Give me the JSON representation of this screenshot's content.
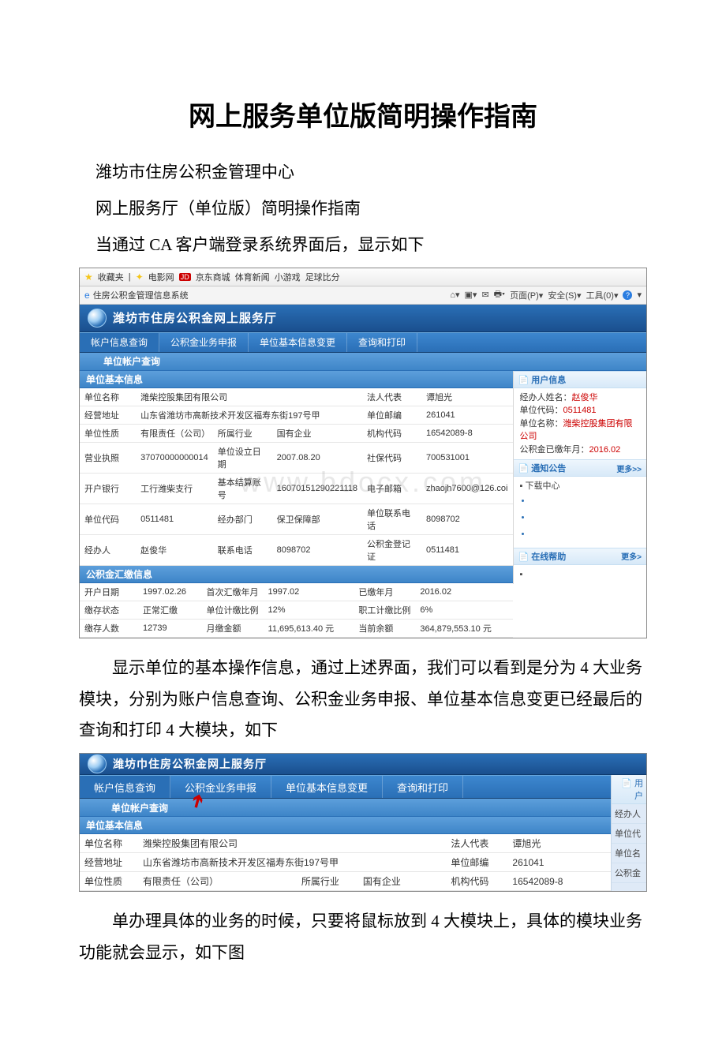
{
  "title": "网上服务单位版简明操作指南",
  "para1": "潍坊市住房公积金管理中心",
  "para2": "网上服务厅（单位版）简明操作指南",
  "para3": "当通过 CA 客户端登录系统界面后，显示如下",
  "para4": "显示单位的基本操作信息，通过上述界面，我们可以看到是分为 4 大业务模块，分别为账户信息查询、公积金业务申报、单位基本信息变更已经最后的查询和打印 4 大模块，如下",
  "para5": "单办理具体的业务的时候，只要将鼠标放到 4 大模块上，具体的模块业务功能就会显示，如下图",
  "favorites": {
    "label": "收藏夹",
    "links": [
      "电影网",
      "京东商城",
      "体育新闻",
      "小游戏",
      "足球比分"
    ]
  },
  "tab_title": "住房公积金管理信息系统",
  "ie_tools": [
    "页面(P)▾",
    "安全(S)▾",
    "工具(0)▾"
  ],
  "banner_text": "潍坊市住房公积金网上服务厅",
  "menu": [
    "帐户信息查询",
    "公积金业务申报",
    "单位基本信息变更",
    "查询和打印"
  ],
  "submenu": "单位帐户查询",
  "sec_basic": "单位基本信息",
  "sec_fund": "公积金汇缴信息",
  "basic": {
    "r1a": "单位名称",
    "r1av": "潍柴控股集团有限公司",
    "r1c": "法人代表",
    "r1cv": "谭旭光",
    "r2a": "经营地址",
    "r2av": "山东省潍坊市高新技术开发区福寿东街197号甲",
    "r2c": "单位邮编",
    "r2cv": "261041",
    "r3a": "单位性质",
    "r3av": "有限责任（公司）",
    "r3b": "所属行业",
    "r3bv": "国有企业",
    "r3c": "机构代码",
    "r3cv": "16542089-8",
    "r4a": "营业执照",
    "r4av": "37070000000014",
    "r4b": "单位设立日期",
    "r4bv": "2007.08.20",
    "r4c": "社保代码",
    "r4cv": "700531001",
    "r5a": "开户银行",
    "r5av": "工行潍柴支行",
    "r5b": "基本结算账号",
    "r5bv": "16070151290221118",
    "r5c": "电子邮箱",
    "r5cv": "zhaojh7600@126.coi",
    "r6a": "单位代码",
    "r6av": "0511481",
    "r6b": "经办部门",
    "r6bv": "保卫保障部",
    "r6c": "单位联系电话",
    "r6cv": "8098702",
    "r7a": "经办人",
    "r7av": "赵俊华",
    "r7b": "联系电话",
    "r7bv": "8098702",
    "r7c": "公积金登记证",
    "r7cv": "0511481"
  },
  "fund": {
    "r1a": "开户日期",
    "r1av": "1997.02.26",
    "r1b": "首次汇缴年月",
    "r1bv": "1997.02",
    "r1c": "已缴年月",
    "r1cv": "2016.02",
    "r2a": "缴存状态",
    "r2av": "正常汇缴",
    "r2b": "单位计缴比例",
    "r2bv": "12%",
    "r2c": "职工计缴比例",
    "r2cv": "6%",
    "r3a": "缴存人数",
    "r3av": "12739",
    "r3b": "月缴金额",
    "r3bv": "11,695,613.40 元",
    "r3c": "当前余额",
    "r3cv": "364,879,553.10 元"
  },
  "userinfo": {
    "hdr": "用户信息",
    "operator_lbl": "经办人姓名：",
    "operator": "赵俊华",
    "code_lbl": "单位代码：",
    "code": "0511481",
    "name_lbl": "单位名称：",
    "name": "潍柴控股集团有限公司",
    "paid_lbl": "公积金已缴年月：",
    "paid": "2016.02"
  },
  "notice_hdr": "通知公告",
  "more": "更多>>",
  "download": "下载中心",
  "help_hdr": "在线帮助",
  "watermark": "www.bdocx.com",
  "ss2": {
    "banner": "潍坊巾住房公积金网上服务厅",
    "right_hdr": "用户",
    "right_lines": [
      "经办人",
      "单位代",
      "单位名",
      "公积金"
    ]
  }
}
